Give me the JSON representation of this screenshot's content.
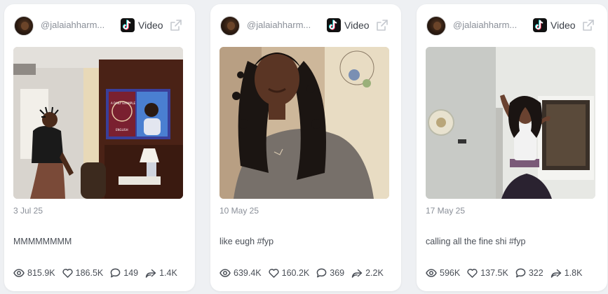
{
  "cards": [
    {
      "username": "@jalaiahharm...",
      "platform_icon": "tiktok-icon",
      "type": "Video",
      "date": "3 Jul 25",
      "caption": "MMMMMMMM",
      "views": "815.9K",
      "likes": "186.5K",
      "comments": "149",
      "shares": "1.4K",
      "tv": {
        "line1": "A DAILY EXAMPLE",
        "line2": "ENGLISH"
      }
    },
    {
      "username": "@jalaiahharm...",
      "platform_icon": "tiktok-icon",
      "type": "Video",
      "date": "10 May 25",
      "caption": "like eugh #fyp",
      "views": "639.4K",
      "likes": "160.2K",
      "comments": "369",
      "shares": "2.2K"
    },
    {
      "username": "@jalaiahharm...",
      "platform_icon": "tiktok-icon",
      "type": "Video",
      "date": "17 May 25",
      "caption": "calling all the fine shi #fyp",
      "views": "596K",
      "likes": "137.5K",
      "comments": "322",
      "shares": "1.8K"
    }
  ],
  "colors": {
    "background": "#eef0f3",
    "card": "#ffffff",
    "muted_text": "#8a8f98",
    "body_text": "#4a4f57"
  }
}
